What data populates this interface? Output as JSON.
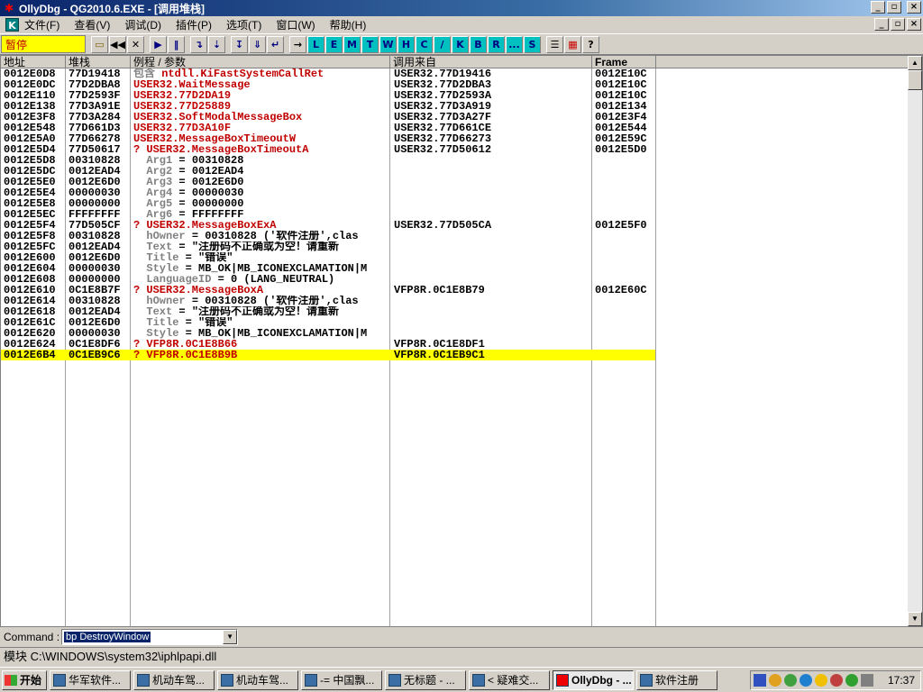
{
  "window": {
    "title": "OllyDbg - QG2010.6.EXE - [调用堆栈]",
    "icon": "olly-bug-icon"
  },
  "menu": {
    "items": [
      "文件(F)",
      "查看(V)",
      "调试(D)",
      "插件(P)",
      "选项(T)",
      "窗口(W)",
      "帮助(H)"
    ]
  },
  "toolbar": {
    "status": "暂停",
    "buttons": [
      "open-icon",
      "rewind-icon",
      "close-icon",
      "run-icon",
      "pause-icon",
      "step-into-icon",
      "step-over-icon",
      "trace-into-icon",
      "trace-over-icon",
      "execute-till-return-icon",
      "goto-icon"
    ],
    "letter_buttons": [
      "L",
      "E",
      "M",
      "T",
      "W",
      "H",
      "C",
      "/",
      "K",
      "B",
      "R",
      "...",
      "S"
    ],
    "end_buttons": [
      "list-icon",
      "palette-icon",
      "help-icon"
    ]
  },
  "table": {
    "headers": [
      "地址",
      "堆栈",
      "例程 / 参数",
      "调用来自",
      "Frame"
    ],
    "rows": [
      {
        "addr": "0012E0D8",
        "val": "77D19418",
        "proc": "包含 ntdll.KiFastSystemCallRet",
        "call": "USER32.77D19416",
        "frame": "0012E10C",
        "style": "mixed"
      },
      {
        "addr": "0012E0DC",
        "val": "77D2DBA8",
        "proc": "USER32.WaitMessage",
        "call": "USER32.77D2DBA3",
        "frame": "0012E10C",
        "style": "red"
      },
      {
        "addr": "0012E110",
        "val": "77D2593F",
        "proc": "USER32.77D2DA19",
        "call": "USER32.77D2593A",
        "frame": "0012E10C",
        "style": "red"
      },
      {
        "addr": "0012E138",
        "val": "77D3A91E",
        "proc": "USER32.77D25889",
        "call": "USER32.77D3A919",
        "frame": "0012E134",
        "style": "red"
      },
      {
        "addr": "0012E3F8",
        "val": "77D3A284",
        "proc": "USER32.SoftModalMessageBox",
        "call": "USER32.77D3A27F",
        "frame": "0012E3F4",
        "style": "red"
      },
      {
        "addr": "0012E548",
        "val": "77D661D3",
        "proc": "USER32.77D3A10F",
        "call": "USER32.77D661CE",
        "frame": "0012E544",
        "style": "red"
      },
      {
        "addr": "0012E5A0",
        "val": "77D66278",
        "proc": "USER32.MessageBoxTimeoutW",
        "call": "USER32.77D66273",
        "frame": "0012E59C",
        "style": "red"
      },
      {
        "addr": "0012E5D4",
        "val": "77D50617",
        "proc": "? USER32.MessageBoxTimeoutA",
        "call": "USER32.77D50612",
        "frame": "0012E5D0",
        "style": "red"
      },
      {
        "addr": "0012E5D8",
        "val": "00310828",
        "proc": "  Arg1 = 00310828",
        "call": "",
        "frame": "",
        "style": "arg"
      },
      {
        "addr": "0012E5DC",
        "val": "0012EAD4",
        "proc": "  Arg2 = 0012EAD4",
        "call": "",
        "frame": "",
        "style": "arg"
      },
      {
        "addr": "0012E5E0",
        "val": "0012E6D0",
        "proc": "  Arg3 = 0012E6D0",
        "call": "",
        "frame": "",
        "style": "arg"
      },
      {
        "addr": "0012E5E4",
        "val": "00000030",
        "proc": "  Arg4 = 00000030",
        "call": "",
        "frame": "",
        "style": "arg"
      },
      {
        "addr": "0012E5E8",
        "val": "00000000",
        "proc": "  Arg5 = 00000000",
        "call": "",
        "frame": "",
        "style": "arg"
      },
      {
        "addr": "0012E5EC",
        "val": "FFFFFFFF",
        "proc": "  Arg6 = FFFFFFFF",
        "call": "",
        "frame": "",
        "style": "arg"
      },
      {
        "addr": "0012E5F4",
        "val": "77D505CF",
        "proc": "? USER32.MessageBoxExA",
        "call": "USER32.77D505CA",
        "frame": "0012E5F0",
        "style": "red"
      },
      {
        "addr": "0012E5F8",
        "val": "00310828",
        "proc": "  hOwner = 00310828 ('软件注册',clas",
        "call": "",
        "frame": "",
        "style": "arg"
      },
      {
        "addr": "0012E5FC",
        "val": "0012EAD4",
        "proc": "  Text = \"注册码不正确或为空！请重新",
        "call": "",
        "frame": "",
        "style": "arg"
      },
      {
        "addr": "0012E600",
        "val": "0012E6D0",
        "proc": "  Title = \"错误\"",
        "call": "",
        "frame": "",
        "style": "arg"
      },
      {
        "addr": "0012E604",
        "val": "00000030",
        "proc": "  Style = MB_OK|MB_ICONEXCLAMATION|M",
        "call": "",
        "frame": "",
        "style": "arg"
      },
      {
        "addr": "0012E608",
        "val": "00000000",
        "proc": "  LanguageID = 0 (LANG_NEUTRAL)",
        "call": "",
        "frame": "",
        "style": "arg"
      },
      {
        "addr": "0012E610",
        "val": "0C1E8B7F",
        "proc": "? USER32.MessageBoxA",
        "call": "VFP8R.0C1E8B79",
        "frame": "0012E60C",
        "style": "red"
      },
      {
        "addr": "0012E614",
        "val": "00310828",
        "proc": "  hOwner = 00310828 ('软件注册',clas",
        "call": "",
        "frame": "",
        "style": "arg"
      },
      {
        "addr": "0012E618",
        "val": "0012EAD4",
        "proc": "  Text = \"注册码不正确或为空！请重新",
        "call": "",
        "frame": "",
        "style": "arg"
      },
      {
        "addr": "0012E61C",
        "val": "0012E6D0",
        "proc": "  Title = \"错误\"",
        "call": "",
        "frame": "",
        "style": "arg"
      },
      {
        "addr": "0012E620",
        "val": "00000030",
        "proc": "  Style = MB_OK|MB_ICONEXCLAMATION|M",
        "call": "",
        "frame": "",
        "style": "arg"
      },
      {
        "addr": "0012E624",
        "val": "0C1E8DF6",
        "proc": "? VFP8R.0C1E8B66",
        "call": "VFP8R.0C1E8DF1",
        "frame": "",
        "style": "red"
      },
      {
        "addr": "0012E6B4",
        "val": "0C1EB9C6",
        "proc": "? VFP8R.0C1E8B9B",
        "call": "VFP8R.0C1EB9C1",
        "frame": "",
        "style": "selected"
      }
    ]
  },
  "command": {
    "label": "Command :",
    "value": "bp DestroyWindow"
  },
  "status": {
    "text": "模块 C:\\WINDOWS\\system32\\iphlpapi.dll"
  },
  "taskbar": {
    "start": "开始",
    "tasks": [
      "华军软件...",
      "机动车驾...",
      "机动车驾...",
      "-= 中国飘...",
      "无标题 - ...",
      "< 疑难交...",
      "OllyDbg - ...",
      "软件注册"
    ],
    "active_index": 6,
    "clock": "17:37"
  },
  "colors": {
    "highlight": "#ffff00",
    "proc_red": "#c00000",
    "arg_gray": "#808080"
  }
}
